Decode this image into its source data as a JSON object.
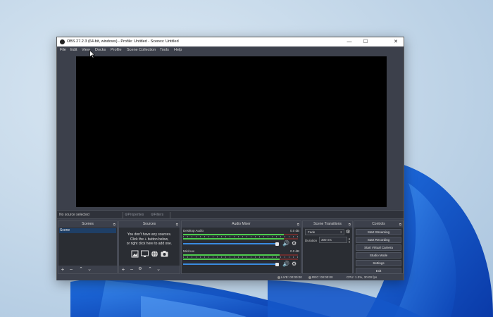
{
  "window": {
    "title": "OBS 27.2.3 (64-bit, windows) - Profile: Untitled - Scenes: Untitled",
    "controls": {
      "minimize": "—",
      "maximize": "☐",
      "close": "✕"
    }
  },
  "menu": {
    "items": [
      "File",
      "Edit",
      "View",
      "Docks",
      "Profile",
      "Scene Collection",
      "Tools",
      "Help"
    ]
  },
  "context_bar": {
    "no_source": "No source selected",
    "properties": "Properties",
    "filters": "Filters"
  },
  "scenes": {
    "header": "Scenes",
    "items": [
      "Scene"
    ]
  },
  "sources": {
    "header": "Sources",
    "empty_line1": "You don't have any sources.",
    "empty_line2": "Click the + button below,",
    "empty_line3": "or right click here to add one."
  },
  "audio_mixer": {
    "header": "Audio Mixer",
    "tracks": [
      {
        "name": "Desktop Audio",
        "db": "0.0 dB",
        "level": 0.88,
        "volume": 1.0
      },
      {
        "name": "Mic/Aux",
        "db": "0.0 dB",
        "level": 0.84,
        "volume": 1.0
      }
    ]
  },
  "transitions": {
    "header": "Scene Transitions",
    "selected": "Fade",
    "duration_label": "Duration",
    "duration_value": "300 ms"
  },
  "controls": {
    "header": "Controls",
    "buttons": [
      "Start Streaming",
      "Start Recording",
      "Start Virtual Camera",
      "Studio Mode",
      "Settings",
      "Exit"
    ]
  },
  "status": {
    "live": "LIVE: 00:00:00",
    "rec": "REC: 00:00:00",
    "cpu": "CPU: 1.3%, 30.00 fps"
  },
  "colors": {
    "panel_bg": "#3c404b",
    "dock_bg": "#2a2d33",
    "accent": "#3a8be0",
    "meter_green": "#4ecc4e"
  }
}
